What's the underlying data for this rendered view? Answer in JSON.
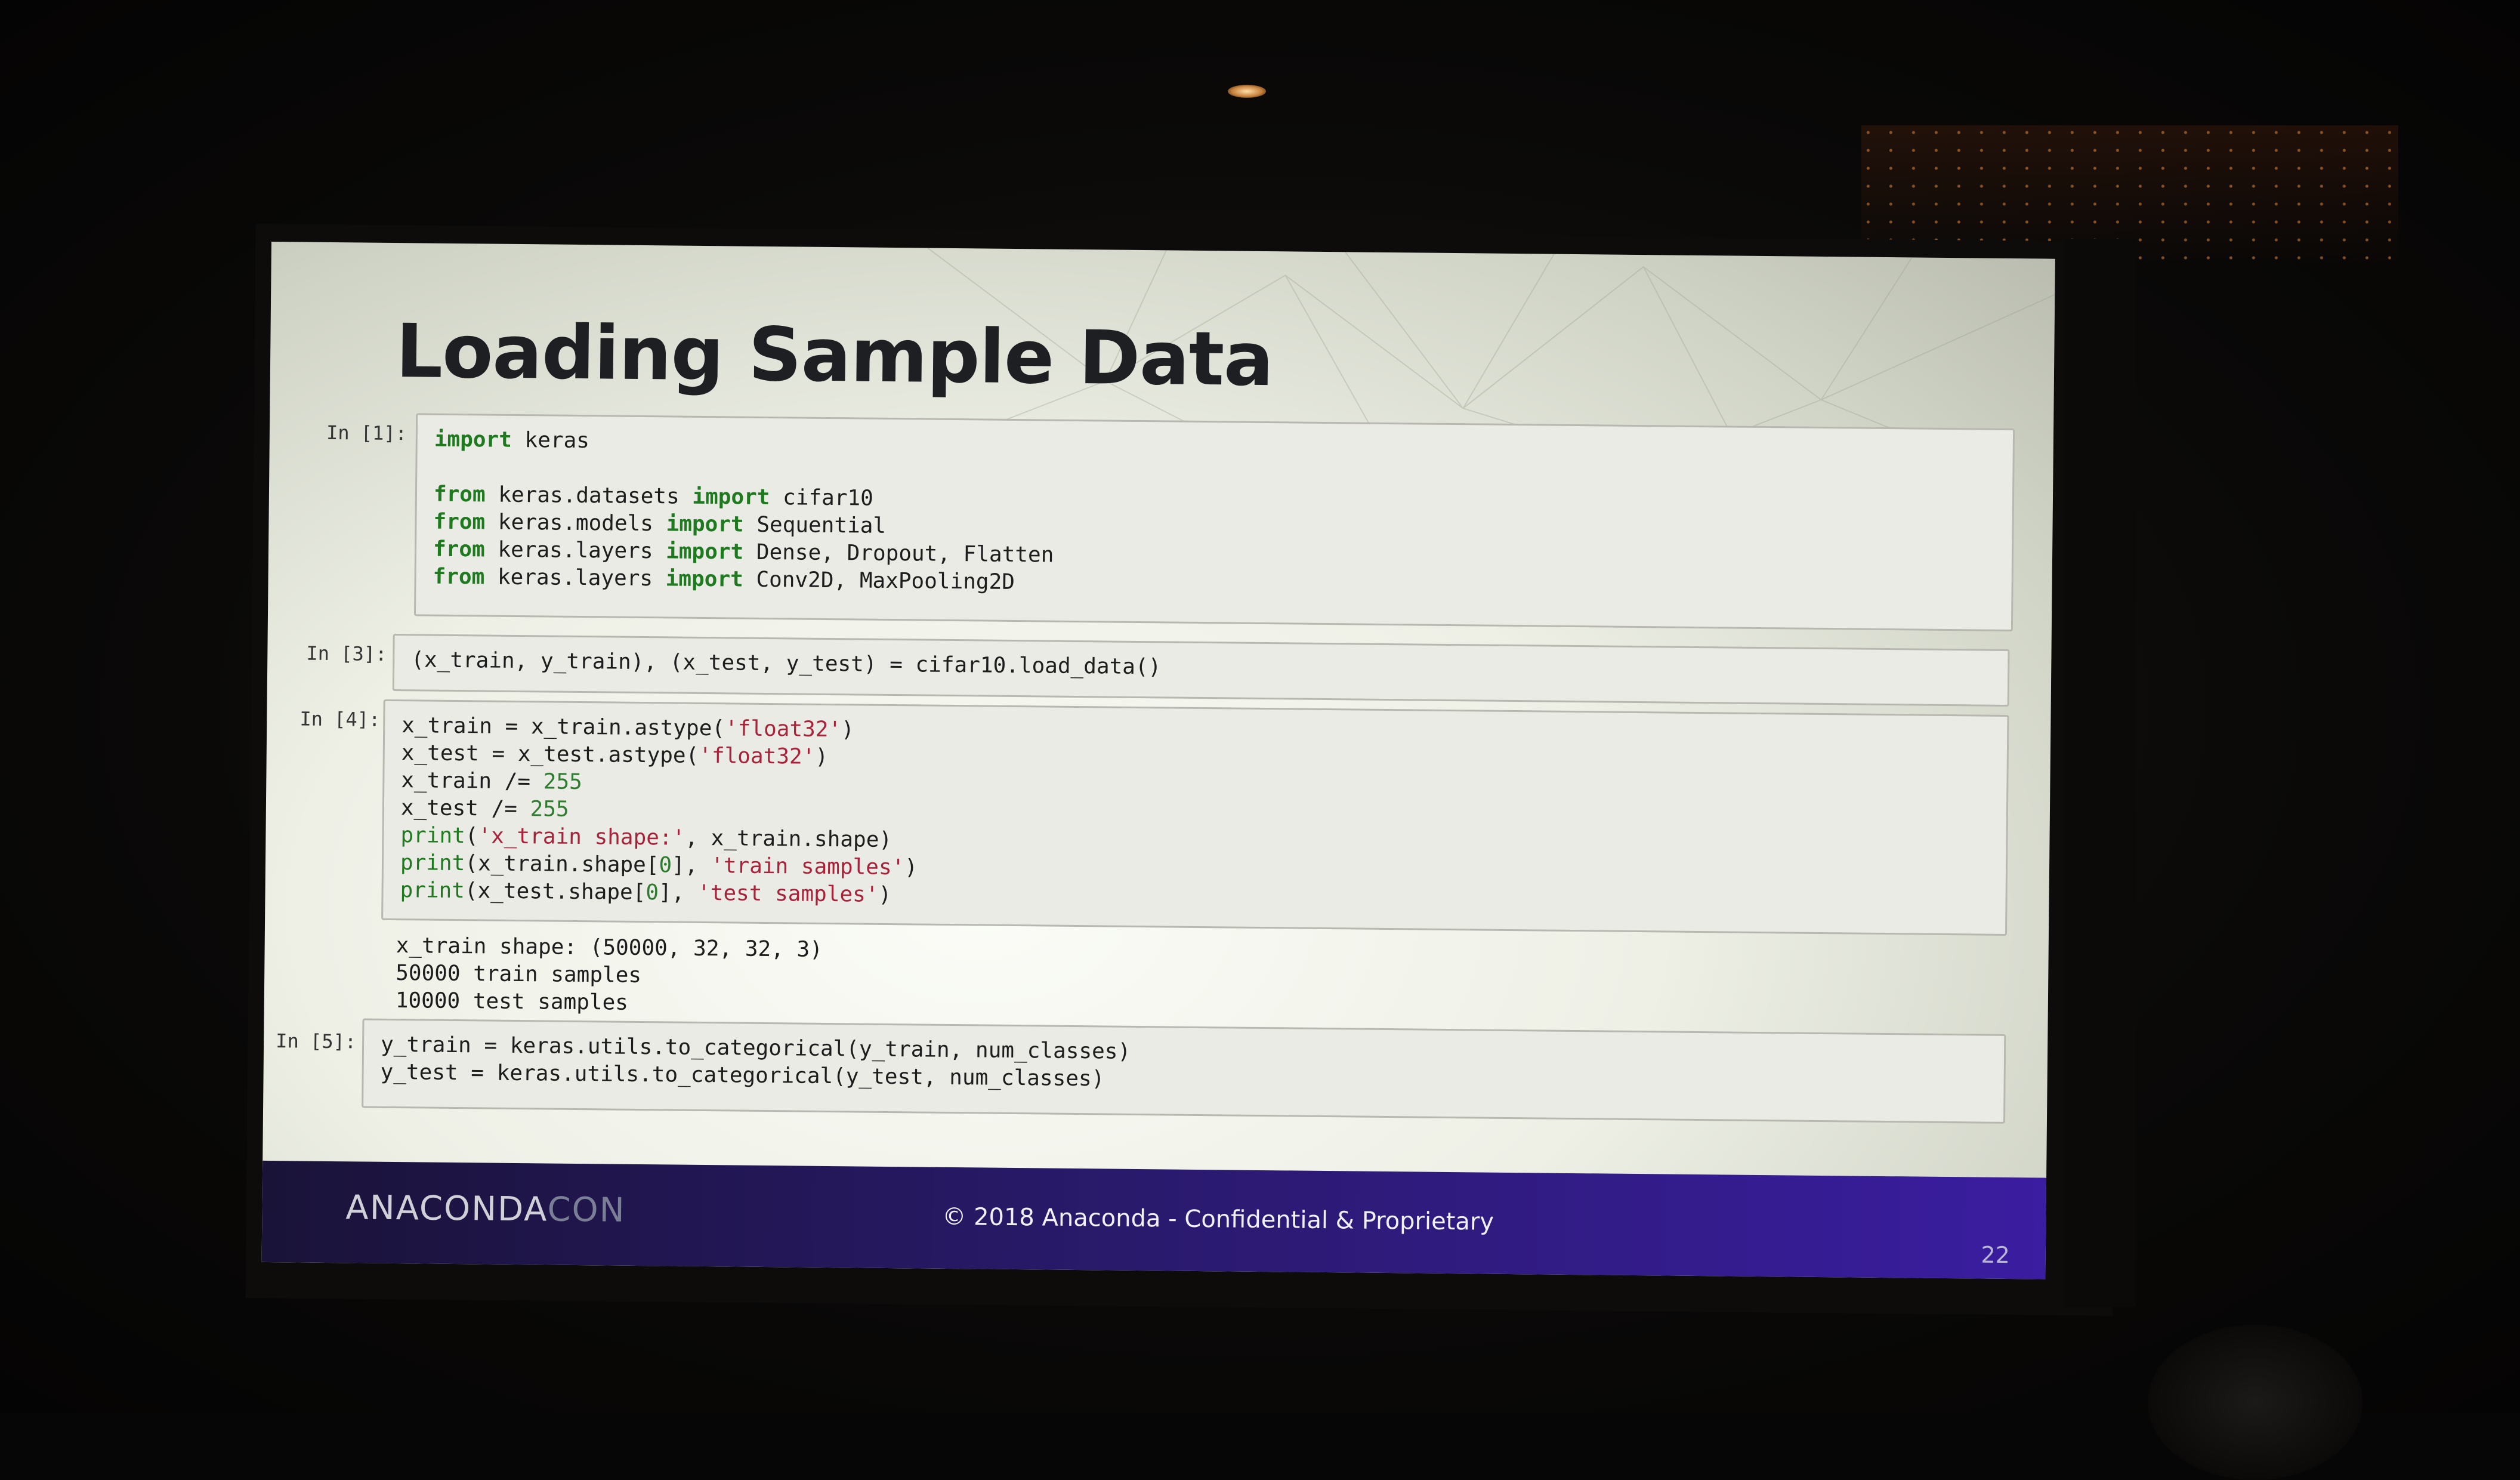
{
  "slide": {
    "title": "Loading Sample Data",
    "cells": [
      {
        "prompt": "In [1]:",
        "lines": [
          [
            {
              "t": "import",
              "c": "kw"
            },
            {
              "t": " keras"
            }
          ],
          [],
          [
            {
              "t": "from",
              "c": "kw"
            },
            {
              "t": " keras.datasets "
            },
            {
              "t": "import",
              "c": "kw"
            },
            {
              "t": " cifar10"
            }
          ],
          [
            {
              "t": "from",
              "c": "kw"
            },
            {
              "t": " keras.models "
            },
            {
              "t": "import",
              "c": "kw"
            },
            {
              "t": " Sequential"
            }
          ],
          [
            {
              "t": "from",
              "c": "kw"
            },
            {
              "t": " keras.layers "
            },
            {
              "t": "import",
              "c": "kw"
            },
            {
              "t": " Dense, Dropout, Flatten"
            }
          ],
          [
            {
              "t": "from",
              "c": "kw"
            },
            {
              "t": " keras.layers "
            },
            {
              "t": "import",
              "c": "kw"
            },
            {
              "t": " Conv2D, MaxPooling2D"
            }
          ]
        ]
      },
      {
        "prompt": "In [3]:",
        "lines": [
          [
            {
              "t": "(x_train, y_train), (x_test, y_test) = cifar10.load_data()"
            }
          ]
        ]
      },
      {
        "prompt": "In [4]:",
        "lines": [
          [
            {
              "t": "x_train = x_train.astype("
            },
            {
              "t": "'float32'",
              "c": "str"
            },
            {
              "t": ")"
            }
          ],
          [
            {
              "t": "x_test = x_test.astype("
            },
            {
              "t": "'float32'",
              "c": "str"
            },
            {
              "t": ")"
            }
          ],
          [
            {
              "t": "x_train /= "
            },
            {
              "t": "255",
              "c": "num"
            }
          ],
          [
            {
              "t": "x_test /= "
            },
            {
              "t": "255",
              "c": "num"
            }
          ],
          [
            {
              "t": "print",
              "c": "fn"
            },
            {
              "t": "("
            },
            {
              "t": "'x_train shape:'",
              "c": "str"
            },
            {
              "t": ", x_train.shape)"
            }
          ],
          [
            {
              "t": "print",
              "c": "fn"
            },
            {
              "t": "(x_train.shape["
            },
            {
              "t": "0",
              "c": "num"
            },
            {
              "t": "], "
            },
            {
              "t": "'train samples'",
              "c": "str"
            },
            {
              "t": ")"
            }
          ],
          [
            {
              "t": "print",
              "c": "fn"
            },
            {
              "t": "(x_test.shape["
            },
            {
              "t": "0",
              "c": "num"
            },
            {
              "t": "], "
            },
            {
              "t": "'test samples'",
              "c": "str"
            },
            {
              "t": ")"
            }
          ]
        ],
        "output": [
          "x_train shape: (50000, 32, 32, 3)",
          "50000 train samples",
          "10000 test samples"
        ]
      },
      {
        "prompt": "In [5]:",
        "lines": [
          [
            {
              "t": "y_train = keras.utils.to_categorical(y_train, num_classes)"
            }
          ],
          [
            {
              "t": "y_test = keras.utils.to_categorical(y_test, num_classes)"
            }
          ]
        ]
      }
    ],
    "footer": {
      "logo_main": "ANACONDA",
      "logo_accent": "CON",
      "copyright": "© 2018 Anaconda - Confidential & Proprietary",
      "page_number": "22"
    }
  },
  "colors": {
    "keyword": "#1f7a1f",
    "string": "#a8233a",
    "number": "#2f7b2f",
    "footer_bar": "#2a1a6e"
  }
}
